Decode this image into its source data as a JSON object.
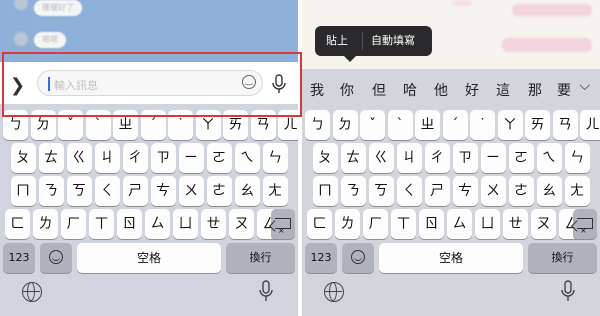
{
  "left": {
    "chat_bubbles": [
      "確權好了",
      "嗯嗯"
    ],
    "input": {
      "placeholder": "輸入訊息",
      "expand_icon": "chevron-right-icon",
      "emoji_icon": "smile-icon",
      "mic_icon": "mic-icon"
    }
  },
  "right": {
    "popup": {
      "paste_label": "貼上",
      "autofill_label": "自動填寫"
    },
    "suggestions": [
      "我",
      "你",
      "但",
      "哈",
      "他",
      "好",
      "這",
      "那",
      "要"
    ],
    "suggest_more_icon": "chevron-down-icon"
  },
  "keyboard": {
    "rows": [
      [
        "ㄅ",
        "ㄉ",
        "ˇ",
        "ˋ",
        "ㄓ",
        "ˊ",
        "˙",
        "ㄚ",
        "ㄞ",
        "ㄢ",
        "ㄦ"
      ],
      [
        "ㄆ",
        "ㄊ",
        "ㄍ",
        "ㄐ",
        "ㄔ",
        "ㄗ",
        "ㄧ",
        "ㄛ",
        "ㄟ",
        "ㄣ"
      ],
      [
        "ㄇ",
        "ㄋ",
        "ㄎ",
        "ㄑ",
        "ㄕ",
        "ㄘ",
        "ㄨ",
        "ㄜ",
        "ㄠ",
        "ㄤ"
      ],
      [
        "ㄈ",
        "ㄌ",
        "ㄏ",
        "ㄒ",
        "ㄖ",
        "ㄙ",
        "ㄩ",
        "ㄝ",
        "ㄡ",
        "ㄥ"
      ]
    ],
    "numbers_key": "123",
    "space_key": "空格",
    "return_key": "換行",
    "delete_icon": "delete-icon",
    "emoji_icon": "emoji-icon",
    "globe_icon": "globe-icon",
    "dictation_icon": "mic-icon"
  },
  "colors": {
    "highlight": "#d9363e",
    "caret": "#2f6fe0",
    "popup_bg": "#2a2a2c"
  }
}
